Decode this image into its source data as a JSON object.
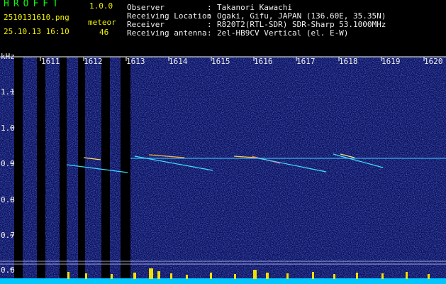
{
  "app": {
    "name": "HROFFT",
    "version": "1.0.0"
  },
  "file": {
    "name": "2510131610.png",
    "datetime": "25.10.13 16:10"
  },
  "meteor": {
    "label": "meteor",
    "count": "46"
  },
  "info": [
    {
      "key": "Observer",
      "value": "Takanori Kawachi"
    },
    {
      "key": "Receiving Location",
      "value": "Ogaki, Gifu, JAPAN (136.60E, 35.35N)"
    },
    {
      "key": "Receiver",
      "value": "R820T2(RTL-SDR) SDR-Sharp 53.1000MHz"
    },
    {
      "key": "Receiving antenna",
      "value": "2el-HB9CV Vertical (el. E-W)"
    }
  ],
  "axis": {
    "y_unit": "kHz",
    "y_ticks": [
      "1.1",
      "1.0",
      "0.9",
      "0.8",
      "0.7",
      "0.6"
    ],
    "x_ticks": [
      "1611",
      "1612",
      "1613",
      "1614",
      "1615",
      "1616",
      "1617",
      "1618",
      "1619",
      "1620"
    ]
  },
  "colors": {
    "background": "#000000",
    "text_yellow": "#f0f000",
    "text_green": "#00ff00",
    "baseline": "#00c8ff",
    "signal": "#f0e000"
  }
}
